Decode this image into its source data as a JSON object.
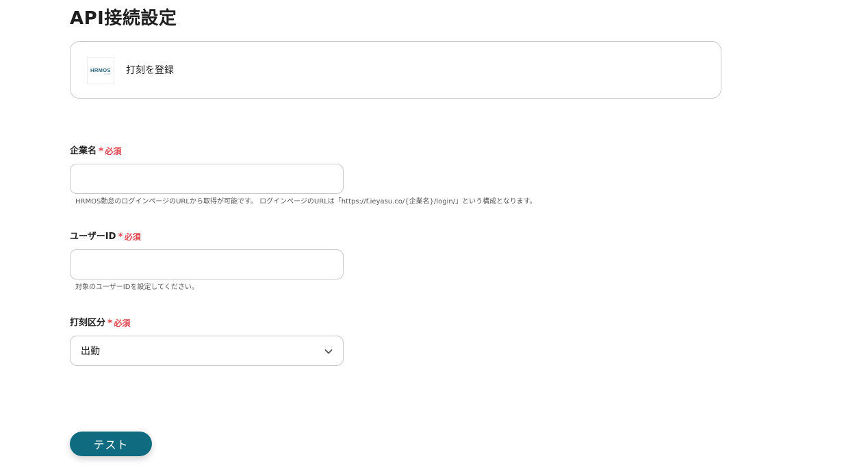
{
  "page": {
    "title": "API接続設定"
  },
  "app_card": {
    "logo_text": "HRMOS",
    "action": "打刻を登録"
  },
  "required": {
    "star": "*",
    "label": "必須"
  },
  "fields": {
    "company": {
      "label": "企業名",
      "value": "",
      "help": "HRMOS勤怠のログインページのURLから取得が可能です。 ログインページのURLは「https://f.ieyasu.co/{企業名}/login/」という構成となります。"
    },
    "user_id": {
      "label": "ユーザーID",
      "value": "",
      "help": "対象のユーザーIDを設定してください。"
    },
    "stamp_type": {
      "label": "打刻区分",
      "selected": "出勤"
    }
  },
  "buttons": {
    "test_label": "テスト"
  },
  "colors": {
    "primary": "#0f6b80",
    "required": "#e0464f",
    "logo": "#1f5f7a"
  },
  "icons": {
    "select": "chevron-down-icon"
  }
}
